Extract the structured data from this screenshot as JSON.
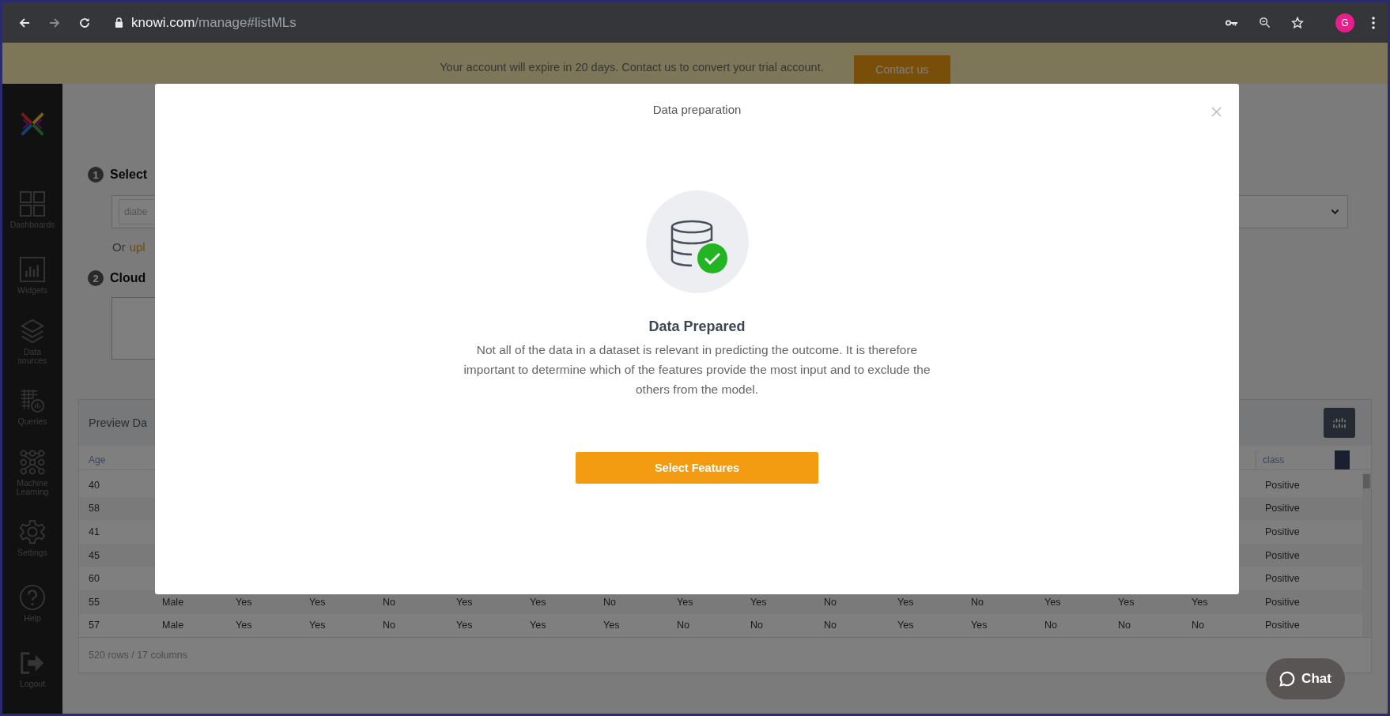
{
  "browser": {
    "url_host": "knowi.com",
    "url_path": "/manage#listMLs",
    "profile_initial": "G"
  },
  "banner": {
    "message": "Your account will expire in 20 days. Contact us to convert your trial account.",
    "button": "Contact us"
  },
  "sidebar": {
    "items": [
      {
        "label": "Dashboards",
        "kind": "dashboards"
      },
      {
        "label": "Widgets",
        "kind": "widgets"
      },
      {
        "label": "Data sources",
        "kind": "datasources"
      },
      {
        "label": "Queries",
        "kind": "queries"
      },
      {
        "label": "Machine Learning",
        "kind": "ml"
      },
      {
        "label": "Settings",
        "kind": "settings"
      },
      {
        "label": "Help",
        "kind": "help"
      },
      {
        "label": "Logout",
        "kind": "logout"
      }
    ]
  },
  "steps": [
    {
      "number": "1",
      "title": "Select"
    },
    {
      "number": "2",
      "title": "Cloud"
    }
  ],
  "dataset_field": {
    "value": "diabe"
  },
  "upload": {
    "text": "Or",
    "link": "upl"
  },
  "preview": {
    "title": "Preview Da",
    "columns": [
      "Age",
      "class"
    ],
    "rows": [
      {
        "cells": [
          "40",
          "Positive"
        ]
      },
      {
        "cells": [
          "58",
          "Positive"
        ]
      },
      {
        "cells": [
          "41",
          "Positive"
        ]
      },
      {
        "cells": [
          "45",
          "Positive"
        ]
      },
      {
        "cells": [
          "60",
          "Positive"
        ]
      },
      {
        "cells": [
          "55",
          "Male",
          "Yes",
          "Yes",
          "No",
          "Yes",
          "Yes",
          "No",
          "Yes",
          "Yes",
          "No",
          "Yes",
          "No",
          "Yes",
          "Yes",
          "Yes",
          "Positive"
        ]
      },
      {
        "cells": [
          "57",
          "Male",
          "Yes",
          "Yes",
          "No",
          "Yes",
          "Yes",
          "Yes",
          "No",
          "No",
          "No",
          "Yes",
          "Yes",
          "No",
          "No",
          "No",
          "Positive"
        ]
      }
    ],
    "footer": "520 rows / 17 columns"
  },
  "modal": {
    "title": "Data preparation",
    "heading": "Data Prepared",
    "text": "Not all of the data in a dataset is relevant in predicting the outcome. It is therefore important to determine which of the features provide the most input and to exclude the others from the model.",
    "button": "Select Features"
  },
  "chat": {
    "label": "Chat"
  }
}
